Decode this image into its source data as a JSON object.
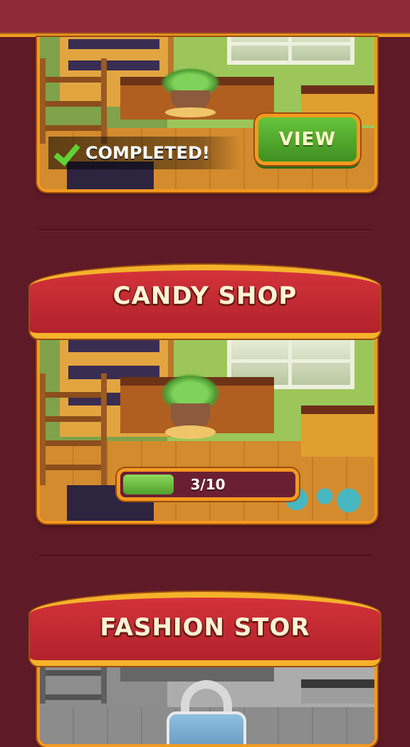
{
  "colors": {
    "background": "#5e1a26",
    "header": "#8e2a3a",
    "frame_orange": "#f49a1f",
    "banner_red": "#c52a33",
    "view_green": "#4fa02e",
    "progress_green": "#6fc043"
  },
  "shops": [
    {
      "title": "",
      "status": "completed",
      "completed_label": "COMPLETED!",
      "view_label": "VIEW"
    },
    {
      "title": "CANDY SHOP",
      "status": "in_progress",
      "progress_text": "3/10",
      "progress": {
        "current": 3,
        "total": 10
      }
    },
    {
      "title": "FASHION STOR",
      "status": "locked",
      "icon": "lock-icon"
    }
  ]
}
